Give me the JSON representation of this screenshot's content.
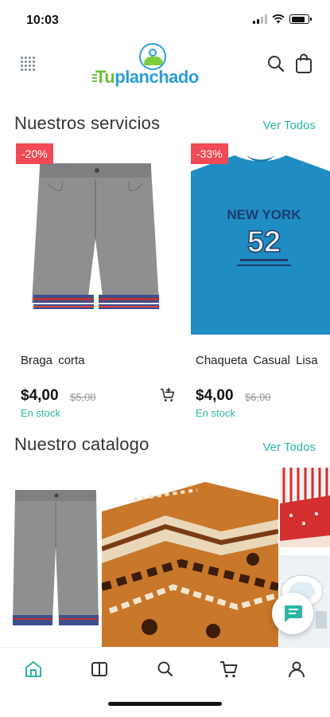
{
  "status_bar": {
    "time": "10:03"
  },
  "header": {
    "logo_text_green": "Tu",
    "logo_text_blue": "planchado"
  },
  "services": {
    "title": "Nuestros servicios",
    "see_all": "Ver Todos",
    "products": [
      {
        "name": "Braga corta",
        "discount": "-20%",
        "price": "$4,00",
        "old_price": "$5,00",
        "stock": "En stock"
      },
      {
        "name": "Chaqueta  Casual  Lisa",
        "discount": "-33%",
        "price": "$4,00",
        "old_price": "$6,00",
        "stock": "En stock"
      }
    ]
  },
  "catalog": {
    "title": "Nuestro catalogo",
    "see_all": "Ver Todos"
  },
  "shirt_print": {
    "line1": "NEW YORK",
    "line2": "52"
  },
  "colors": {
    "accent": "#2bb5a5",
    "badge": "#ef4a55",
    "logo_green": "#6cc13a",
    "logo_blue": "#2a9fd8"
  },
  "bottom_nav": [
    "home-icon",
    "catalog-icon",
    "search-icon",
    "cart-icon",
    "user-icon"
  ]
}
